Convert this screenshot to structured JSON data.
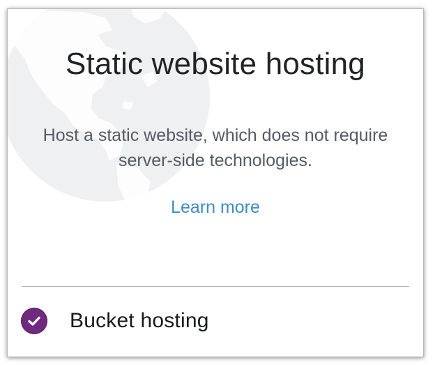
{
  "card": {
    "title": "Static website hosting",
    "description": "Host a static website, which does not require server-side technologies.",
    "learn_more_label": "Learn more",
    "status_label": "Bucket hosting",
    "status_checked": true
  },
  "icons": {
    "background": "globe-icon",
    "status": "check-circle-icon"
  },
  "colors": {
    "title": "#1f2326",
    "description": "#545b64",
    "link": "#3d8cc4",
    "check_badge": "#6f2a7e",
    "globe_tint": "#f1f3f4"
  }
}
